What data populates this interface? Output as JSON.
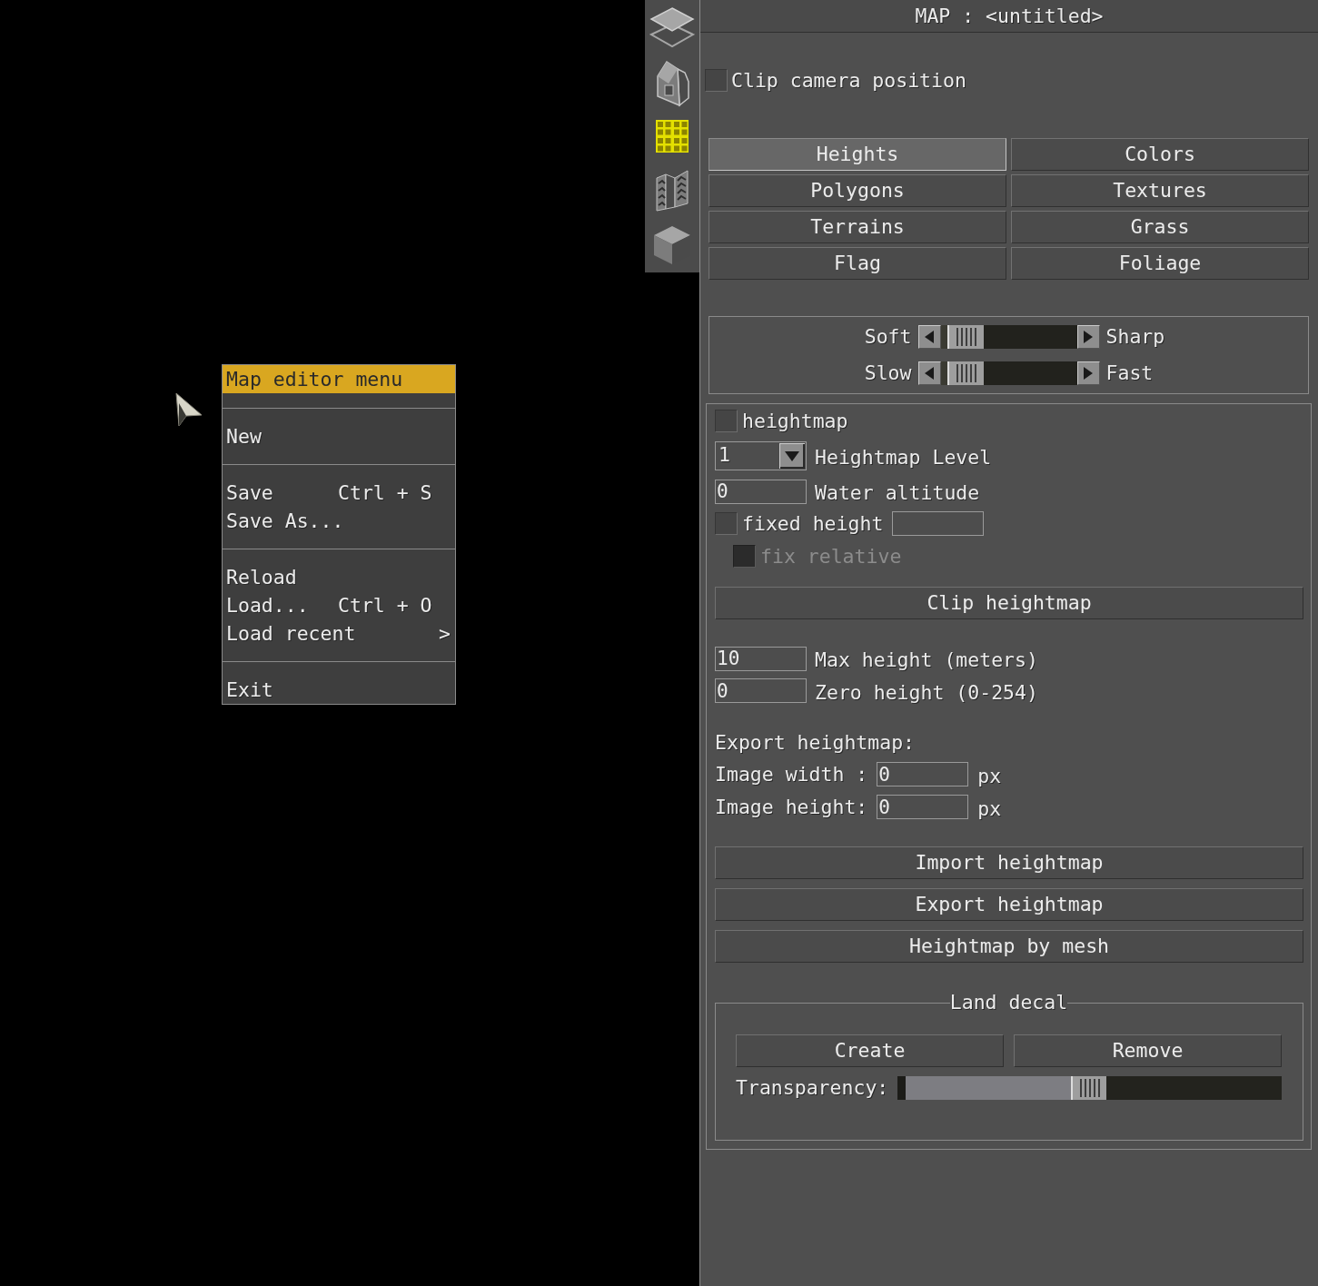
{
  "toolbar": {
    "tools": [
      {
        "kind": "layers",
        "selected": false
      },
      {
        "kind": "house",
        "selected": false
      },
      {
        "kind": "grid",
        "selected": true
      },
      {
        "kind": "walls",
        "selected": false
      },
      {
        "kind": "cube",
        "selected": false
      }
    ]
  },
  "menu": {
    "title": "Map editor menu",
    "sections": [
      [
        {
          "label": "New"
        }
      ],
      [
        {
          "label": "Save",
          "shortcut": "Ctrl + S"
        },
        {
          "label": "Save As..."
        }
      ],
      [
        {
          "label": "Reload"
        },
        {
          "label": "Load...",
          "shortcut": "Ctrl + O"
        },
        {
          "label": "Load recent",
          "submenu": ">"
        }
      ],
      [
        {
          "label": "Exit"
        }
      ]
    ]
  },
  "panel": {
    "title": "MAP : <untitled>",
    "clip_camera": {
      "label": "Clip camera position",
      "checked": false
    },
    "modes": [
      {
        "label": "Heights",
        "selected": true
      },
      {
        "label": "Colors",
        "selected": false
      },
      {
        "label": "Polygons",
        "selected": false
      },
      {
        "label": "Textures",
        "selected": false
      },
      {
        "label": "Terrains",
        "selected": false
      },
      {
        "label": "Grass",
        "selected": false
      },
      {
        "label": "Flag",
        "selected": false
      },
      {
        "label": "Foliage",
        "selected": false
      }
    ],
    "brush_sliders": [
      {
        "left_label": "Soft",
        "right_label": "Sharp",
        "level": 0.05
      },
      {
        "left_label": "Slow",
        "right_label": "Fast",
        "level": 0.05
      }
    ],
    "heightmap": {
      "toggle": {
        "label": "heightmap",
        "checked": false
      },
      "level_dropdown": {
        "value": "1",
        "label": "Heightmap Level"
      },
      "water_altitude": {
        "value": "0",
        "label": "Water altitude"
      },
      "fixed_height": {
        "label": "fixed height",
        "checked": false
      },
      "fix_relative": {
        "label": "fix relative",
        "checked": false,
        "disabled": true
      },
      "clip_button": "Clip heightmap",
      "max_height": {
        "value": "10",
        "label": "Max height (meters)"
      },
      "zero_height": {
        "value": "0",
        "label": "Zero height (0-254)"
      },
      "export_title": "Export heightmap:",
      "image_fields": [
        {
          "label": "Image width :",
          "value": "0",
          "unit": "px"
        },
        {
          "label": "Image height:",
          "value": "0",
          "unit": "px"
        }
      ],
      "actions": [
        "Import heightmap",
        "Export heightmap",
        "Heightmap by mesh"
      ],
      "land_decal": {
        "title": "Land decal",
        "buttons": [
          "Create",
          "Remove"
        ],
        "transparency": {
          "label": "Transparency:",
          "level": 0.44
        }
      }
    }
  }
}
